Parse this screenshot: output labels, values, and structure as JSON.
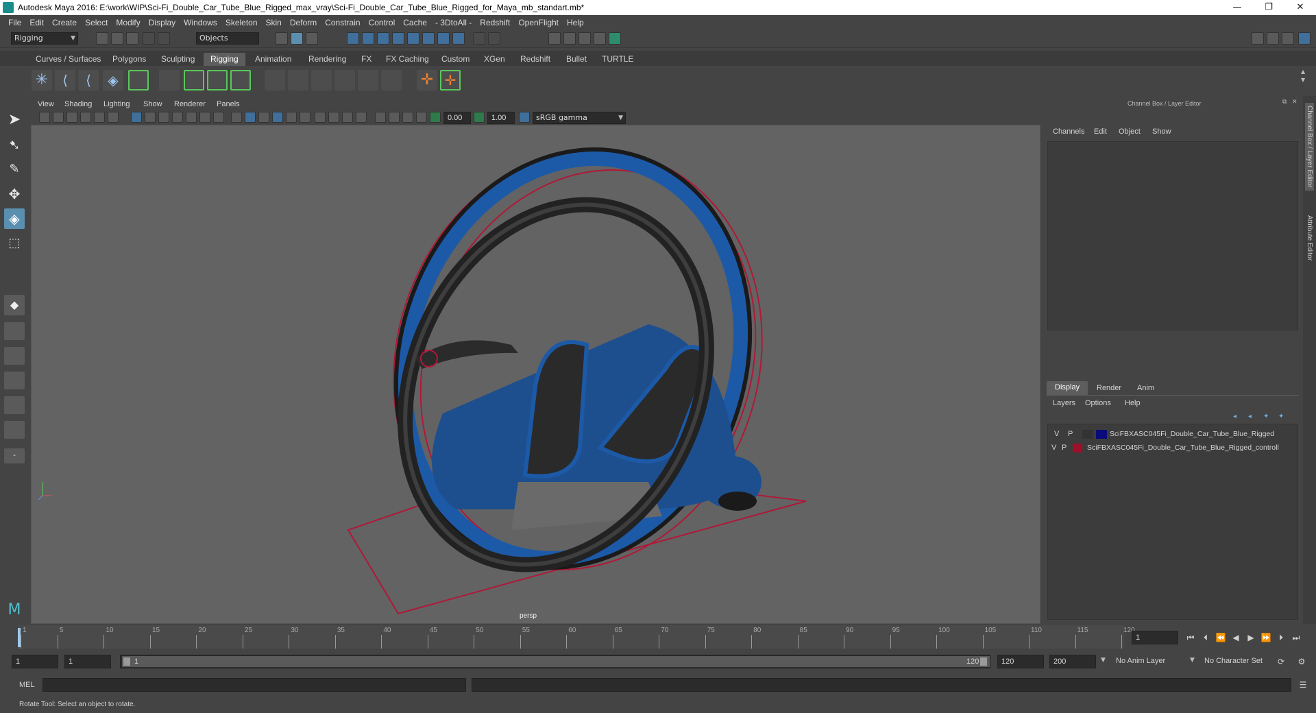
{
  "window": {
    "title": "Autodesk Maya 2016: E:\\work\\WIP\\Sci-Fi_Double_Car_Tube_Blue_Rigged_max_vray\\Sci-Fi_Double_Car_Tube_Blue_Rigged_for_Maya_mb_standart.mb*",
    "minimize": "—",
    "restore": "❐",
    "close": "✕"
  },
  "menu": [
    "File",
    "Edit",
    "Create",
    "Select",
    "Modify",
    "Display",
    "Windows",
    "Skeleton",
    "Skin",
    "Deform",
    "Constrain",
    "Control",
    "Cache",
    "- 3DtoAll -",
    "Redshift",
    "OpenFlight",
    "Help"
  ],
  "statusline": {
    "menuset": "Rigging",
    "selection_mode": "Objects"
  },
  "shelf_tabs": [
    "Curves / Surfaces",
    "Polygons",
    "Sculpting",
    "Rigging",
    "Animation",
    "Rendering",
    "FX",
    "FX Caching",
    "Custom",
    "XGen",
    "Redshift",
    "Bullet",
    "TURTLE"
  ],
  "active_shelf_tab": "Rigging",
  "viewport_menu": [
    "View",
    "Shading",
    "Lighting",
    "Show",
    "Renderer",
    "Panels"
  ],
  "viewport_toolbar": {
    "exposure": "0.00",
    "gamma": "1.00",
    "color_space": "sRGB gamma"
  },
  "viewport": {
    "camera_label": "persp"
  },
  "channel_box": {
    "title": "Channel Box / Layer Editor",
    "menu": [
      "Channels",
      "Edit",
      "Object",
      "Show"
    ]
  },
  "layer_editor": {
    "tabs": [
      "Display",
      "Render",
      "Anim"
    ],
    "active_tab": "Display",
    "menu": [
      "Layers",
      "Options",
      "Help"
    ],
    "layers": [
      {
        "v": "V",
        "p": "P",
        "color": "#0a0a7a",
        "name": "SciFBXASC045Fi_Double_Car_Tube_Blue_Rigged"
      },
      {
        "v": "V",
        "p": "P",
        "color": "#a0102a",
        "name": "SciFBXASC045Fi_Double_Car_Tube_Blue_Rigged_controll"
      }
    ]
  },
  "side_tabs": [
    "Channel Box / Layer Editor",
    "Attribute Editor"
  ],
  "timeline": {
    "ticks": [
      "1",
      "5",
      "10",
      "15",
      "20",
      "25",
      "30",
      "35",
      "40",
      "45",
      "50",
      "55",
      "60",
      "65",
      "70",
      "75",
      "80",
      "85",
      "90",
      "95",
      "100",
      "105",
      "110",
      "115",
      "120"
    ],
    "current_frame": "1"
  },
  "range": {
    "start": "1",
    "inner_start": "1",
    "slider_start": "1",
    "slider_end": "120",
    "inner_end": "120",
    "end": "200",
    "anim_layer": "No Anim Layer",
    "character_set": "No Character Set"
  },
  "cmdline": {
    "label": "MEL"
  },
  "helpline": {
    "text": "Rotate Tool: Select an object to rotate."
  },
  "colors": {
    "accent": "#5d8fb5",
    "control_curve": "#b01838",
    "car_blue": "#1c5aa8"
  }
}
